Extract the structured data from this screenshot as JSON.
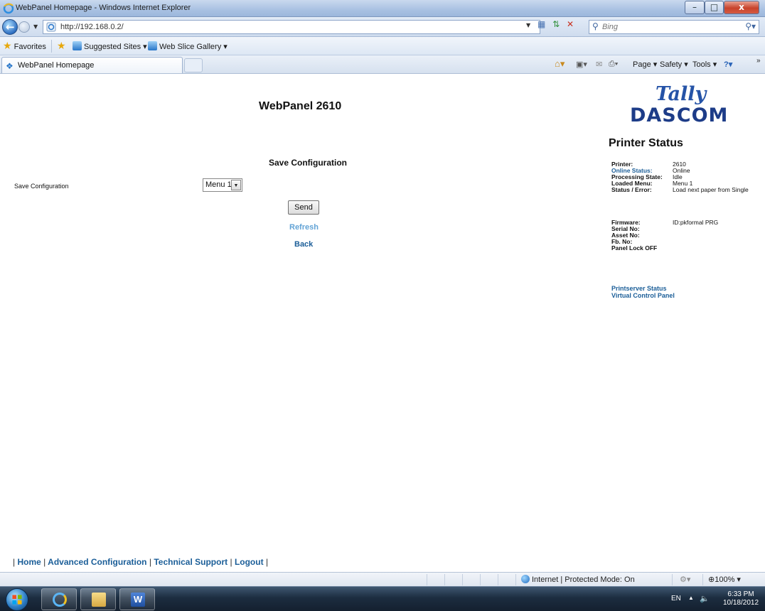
{
  "window": {
    "title": "WebPanel Homepage - Windows Internet Explorer",
    "min": "–",
    "max": "□",
    "close": "x"
  },
  "address": {
    "url": "http://192.168.0.2/",
    "search_placeholder": "Bing"
  },
  "favorites": {
    "favorites_label": "Favorites",
    "suggested_sites": "Suggested Sites ▾",
    "web_slice_gallery": "Web Slice Gallery ▾"
  },
  "tabs": {
    "active_label": "WebPanel Homepage"
  },
  "commands": {
    "page": "Page ▾",
    "safety": "Safety ▾",
    "tools": "Tools ▾",
    "help": "?▾"
  },
  "page": {
    "title": "WebPanel 2610",
    "section_heading": "Save Configuration",
    "config_label": "Save Configuration",
    "menu_value": "Menu 1",
    "send_label": "Send",
    "refresh_label": "Refresh",
    "back_label": "Back"
  },
  "logo": {
    "line1": "Tally",
    "line2": "DASCOM"
  },
  "printer_status": {
    "heading": "Printer Status",
    "rows": [
      {
        "key": "Printer:",
        "value": "2610"
      },
      {
        "key": "Online Status:",
        "value": "Online"
      },
      {
        "key": "Processing State:",
        "value": "Idle"
      },
      {
        "key": "Loaded Menu:",
        "value": "Menu 1"
      },
      {
        "key": "Status / Error:",
        "value": "Load next paper from Single"
      }
    ],
    "rows2": [
      {
        "key": "Firmware:",
        "value": "ID:pkformal PRG"
      },
      {
        "key": "Serial No:",
        "value": ""
      },
      {
        "key": "Asset No:",
        "value": ""
      },
      {
        "key": "Fb. No:",
        "value": ""
      },
      {
        "key": "Panel Lock OFF",
        "value": ""
      }
    ],
    "printserver_link": "Printserver Status",
    "vcp_link": "Virtual Control Panel"
  },
  "footer": {
    "home": "Home",
    "advanced": "Advanced Configuration",
    "support": "Technical Support",
    "logout": "Logout"
  },
  "statusbar": {
    "zone": "Internet | Protected Mode: On",
    "zoom": "⊕100%  ▾"
  },
  "tray": {
    "lang": "EN",
    "time": "6:33 PM",
    "date": "10/18/2012"
  },
  "colors": {
    "link_blue": "#1b5e98",
    "refresh_blue": "#62a3d6",
    "logo_blue": "#2553a7"
  }
}
